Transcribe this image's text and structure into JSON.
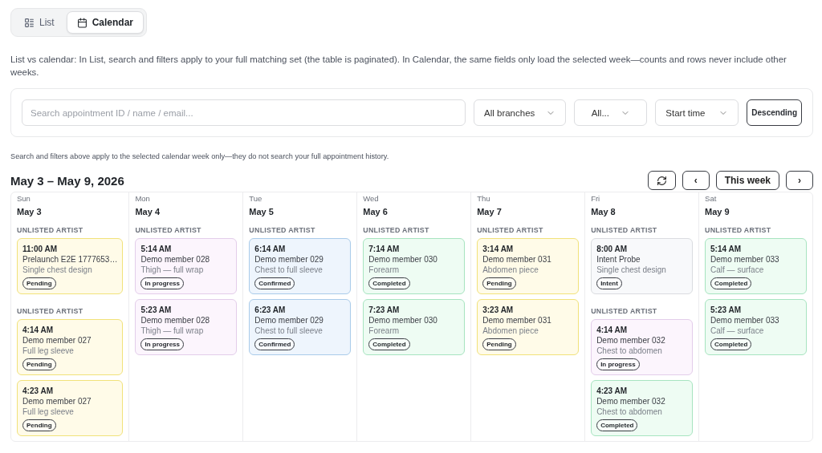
{
  "view_toggle": [
    {
      "label": "List",
      "selected": false
    },
    {
      "label": "Calendar",
      "selected": true
    }
  ],
  "description": "List vs calendar: In List, search and filters apply to your full matching set (the table is paginated). In Calendar, the same fields only load the selected week—counts and rows never include other weeks.",
  "filters": {
    "search": {
      "placeholder": "Search appointment ID / name / email..."
    },
    "selects": [
      "All branches",
      "All...",
      "Start time"
    ],
    "sort_button": "Descending"
  },
  "note": "Search and filters above apply to the selected calendar week only—they do not search your full appointment history.",
  "week_title": "May 3 – May 9, 2026",
  "nav": {
    "prev": "‹",
    "this_week": "This week",
    "next": "›"
  },
  "days": [
    {
      "weekday": "Sun",
      "date": "May 3",
      "groups": [
        {
          "artist": "UNLISTED ARTIST",
          "appointments": [
            {
              "time": "11:00 AM",
              "client": "Prelaunch E2E 1777653…",
              "service": "Single chest design",
              "status": "Pending",
              "kind": "pending"
            }
          ]
        },
        {
          "artist": "UNLISTED ARTIST",
          "appointments": [
            {
              "time": "4:14 AM",
              "client": "Demo member 027",
              "service": "Full leg sleeve",
              "status": "Pending",
              "kind": "pending"
            },
            {
              "time": "4:23 AM",
              "client": "Demo member 027",
              "service": "Full leg sleeve",
              "status": "Pending",
              "kind": "pending"
            }
          ]
        }
      ]
    },
    {
      "weekday": "Mon",
      "date": "May 4",
      "groups": [
        {
          "artist": "UNLISTED ARTIST",
          "appointments": [
            {
              "time": "5:14 AM",
              "client": "Demo member 028",
              "service": "Thigh — full wrap",
              "status": "In progress",
              "kind": "in_progress"
            },
            {
              "time": "5:23 AM",
              "client": "Demo member 028",
              "service": "Thigh — full wrap",
              "status": "In progress",
              "kind": "in_progress"
            }
          ]
        }
      ]
    },
    {
      "weekday": "Tue",
      "date": "May 5",
      "groups": [
        {
          "artist": "UNLISTED ARTIST",
          "appointments": [
            {
              "time": "6:14 AM",
              "client": "Demo member 029",
              "service": "Chest to full sleeve",
              "status": "Confirmed",
              "kind": "confirmed"
            },
            {
              "time": "6:23 AM",
              "client": "Demo member 029",
              "service": "Chest to full sleeve",
              "status": "Confirmed",
              "kind": "confirmed"
            }
          ]
        }
      ]
    },
    {
      "weekday": "Wed",
      "date": "May 6",
      "groups": [
        {
          "artist": "UNLISTED ARTIST",
          "appointments": [
            {
              "time": "7:14 AM",
              "client": "Demo member 030",
              "service": "Forearm",
              "status": "Completed",
              "kind": "completed"
            },
            {
              "time": "7:23 AM",
              "client": "Demo member 030",
              "service": "Forearm",
              "status": "Completed",
              "kind": "completed"
            }
          ]
        }
      ]
    },
    {
      "weekday": "Thu",
      "date": "May 7",
      "groups": [
        {
          "artist": "UNLISTED ARTIST",
          "appointments": [
            {
              "time": "3:14 AM",
              "client": "Demo member 031",
              "service": "Abdomen piece",
              "status": "Pending",
              "kind": "pending"
            },
            {
              "time": "3:23 AM",
              "client": "Demo member 031",
              "service": "Abdomen piece",
              "status": "Pending",
              "kind": "pending"
            }
          ]
        }
      ]
    },
    {
      "weekday": "Fri",
      "date": "May 8",
      "groups": [
        {
          "artist": "UNLISTED ARTIST",
          "appointments": [
            {
              "time": "8:00 AM",
              "client": "Intent Probe",
              "service": "Single chest design",
              "status": "Intent",
              "kind": "intent"
            }
          ]
        },
        {
          "artist": "UNLISTED ARTIST",
          "appointments": [
            {
              "time": "4:14 AM",
              "client": "Demo member 032",
              "service": "Chest to abdomen",
              "status": "In progress",
              "kind": "in_progress"
            },
            {
              "time": "4:23 AM",
              "client": "Demo member 032",
              "service": "Chest to abdomen",
              "status": "Completed",
              "kind": "completed"
            }
          ]
        }
      ]
    },
    {
      "weekday": "Sat",
      "date": "May 9",
      "groups": [
        {
          "artist": "UNLISTED ARTIST",
          "appointments": [
            {
              "time": "5:14 AM",
              "client": "Demo member 033",
              "service": "Calf — surface",
              "status": "Completed",
              "kind": "completed"
            },
            {
              "time": "5:23 AM",
              "client": "Demo member 033",
              "service": "Calf — surface",
              "status": "Completed",
              "kind": "completed"
            }
          ]
        }
      ]
    }
  ]
}
